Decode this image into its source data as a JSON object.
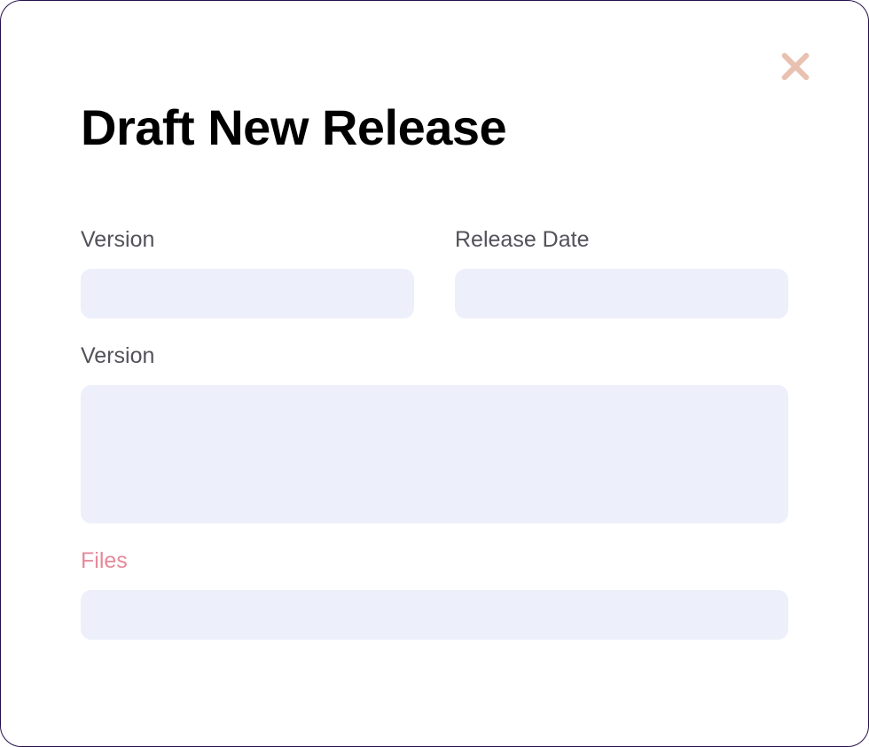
{
  "modal": {
    "title": "Draft New Release",
    "fields": {
      "version": {
        "label": "Version",
        "value": ""
      },
      "release_date": {
        "label": "Release Date",
        "value": ""
      },
      "description": {
        "label": "Version",
        "value": ""
      },
      "files": {
        "label": "Files",
        "value": ""
      }
    }
  },
  "colors": {
    "input_bg": "#edf0fa",
    "label": "#52525b",
    "accent_label": "#e58a9a",
    "close_icon": "#e9c1b1",
    "border": "#27104e"
  }
}
